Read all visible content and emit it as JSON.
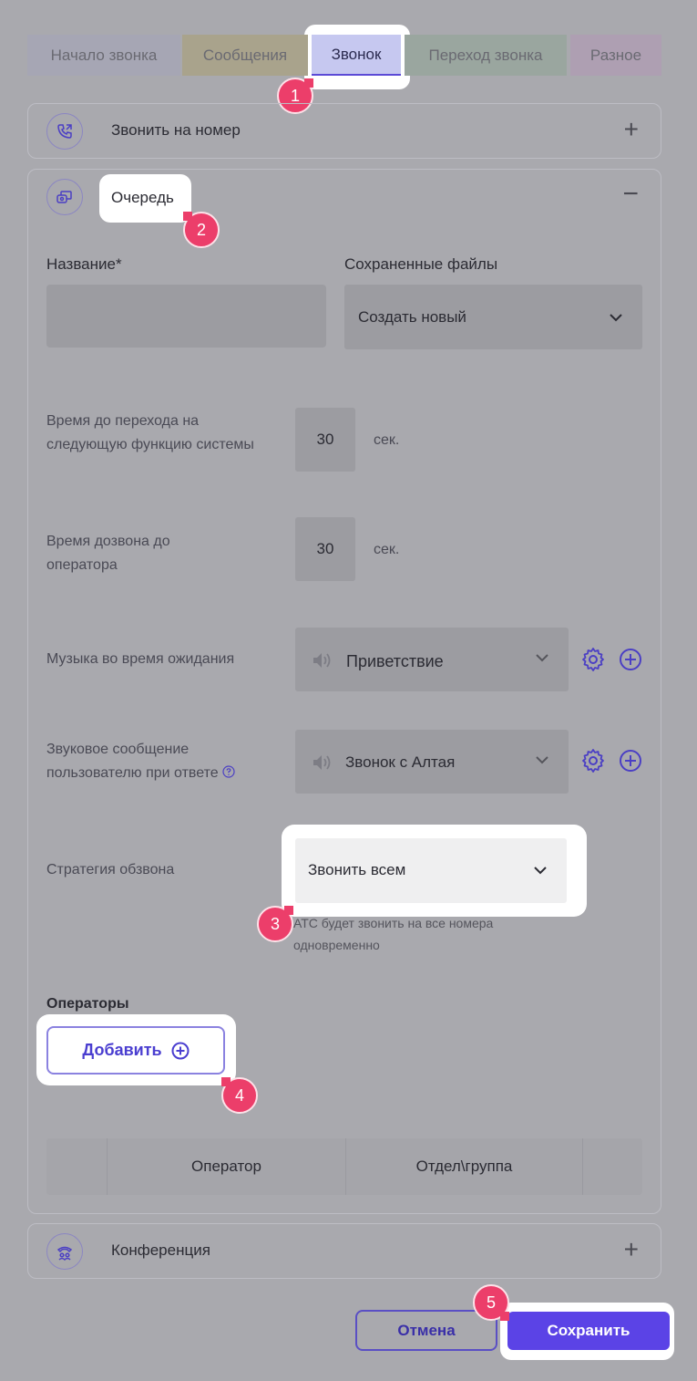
{
  "tabs": [
    {
      "label": "Начало звонка"
    },
    {
      "label": "Сообщения"
    },
    {
      "label": "Звонок"
    },
    {
      "label": "Переход звонка"
    },
    {
      "label": "Разное"
    }
  ],
  "cards": {
    "call_number": {
      "title": "Звонить на номер",
      "icon": "phone-forward-icon",
      "toggle": "+"
    },
    "queue": {
      "title": "Очередь",
      "icon": "queue-icon",
      "toggle": "−"
    },
    "conference": {
      "title": "Конференция",
      "icon": "conference-icon",
      "toggle": "+"
    }
  },
  "form": {
    "name_label": "Название*",
    "name_value": "",
    "saved_files_label": "Сохраненные файлы",
    "saved_files_value": "Создать новый",
    "next_function_time_label": "Время до перехода на следующую функцию системы",
    "next_function_time_value": "30",
    "next_function_time_unit": "сек.",
    "operator_ring_time_label": "Время дозвона до оператора",
    "operator_ring_time_value": "30",
    "operator_ring_time_unit": "сек.",
    "hold_music_label": "Музыка во время ожидания",
    "hold_music_value": "Приветствие",
    "answer_message_label": "Звуковое сообщение пользователю при ответе",
    "answer_message_value": "Звонок с Алтая",
    "strategy_label": "Стратегия обзвона",
    "strategy_value": "Звонить всем",
    "strategy_hint": "АТС будет звонить на все номера одновременно"
  },
  "operators": {
    "title": "Операторы",
    "add_label": "Добавить",
    "columns": [
      "Оператор",
      "Отдел\\группа"
    ]
  },
  "footer": {
    "cancel_label": "Отмена",
    "save_label": "Сохранить"
  },
  "badges": [
    "1",
    "2",
    "3",
    "4",
    "5"
  ],
  "colors": {
    "accent": "#5b43e6",
    "badge": "#ec3e6a",
    "overlay": "#a9a9ae"
  }
}
